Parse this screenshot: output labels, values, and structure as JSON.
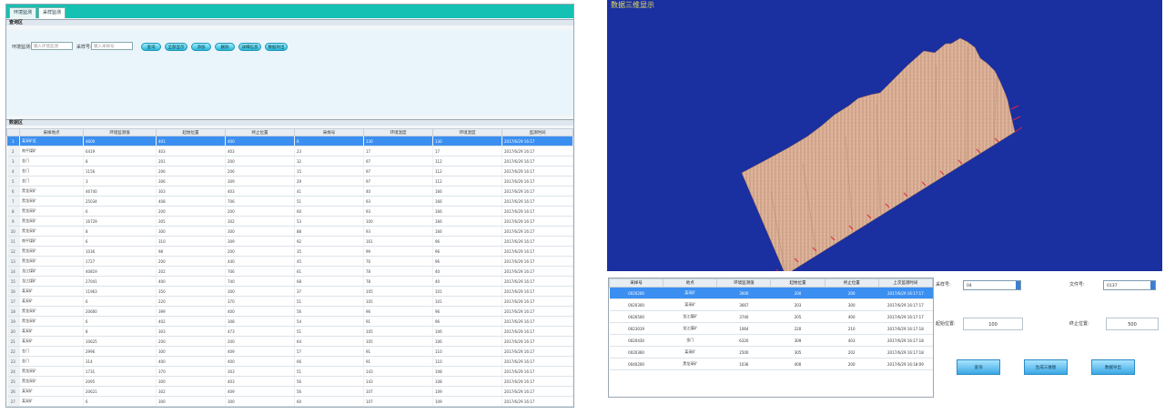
{
  "left": {
    "tabs": [
      "环境监测",
      "采样监测"
    ],
    "query_title": "查询区",
    "grid_title": "数据区",
    "query": {
      "label1": "环境监测:",
      "placeholder1": "输入环境监测",
      "label2": "采样号:",
      "placeholder2": "输入采样号",
      "buttons": [
        "查询",
        "全部显示",
        "添加",
        "删除",
        "详细信息",
        "数据导出"
      ]
    },
    "columns": [
      "",
      "采样地点",
      "环境监测值",
      "起始位置",
      "终止位置",
      "采样号",
      "环境温度",
      "环境湿度",
      "监测时间"
    ],
    "rows": [
      [
        "1",
        "某采矿区",
        "4600",
        "401",
        "400",
        "6",
        "130",
        "130",
        "2017/6/29 16:17"
      ],
      [
        "2",
        "南平煤矿",
        "6419",
        "403",
        "403",
        "23",
        "17",
        "17",
        "2017/6/29 16:17"
      ],
      [
        "3",
        "金门",
        "8",
        "201",
        "200",
        "32",
        "97",
        "112",
        "2017/6/29 16:17"
      ],
      [
        "4",
        "金门",
        "1156",
        "206",
        "206",
        "15",
        "97",
        "112",
        "2017/6/29 16:17"
      ],
      [
        "5",
        "金门",
        "3",
        "306",
        "309",
        "29",
        "97",
        "112",
        "2017/6/29 16:17"
      ],
      [
        "6",
        "黑龙采矿",
        "46740",
        "303",
        "403",
        "41",
        "40",
        "166",
        "2017/6/29 16:17"
      ],
      [
        "7",
        "黑龙采矿",
        "25034",
        "408",
        "706",
        "51",
        "93",
        "166",
        "2017/6/29 16:17"
      ],
      [
        "8",
        "黑龙采矿",
        "6",
        "200",
        "200",
        "60",
        "93",
        "166",
        "2017/6/29 16:17"
      ],
      [
        "9",
        "黑龙采矿",
        "16729",
        "305",
        "302",
        "53",
        "100",
        "166",
        "2017/6/29 16:17"
      ],
      [
        "10",
        "黑龙采矿",
        "8",
        "300",
        "300",
        "88",
        "93",
        "166",
        "2017/6/29 16:17"
      ],
      [
        "11",
        "南平煤矿",
        "6",
        "310",
        "309",
        "92",
        "161",
        "96",
        "2017/6/29 16:17"
      ],
      [
        "12",
        "黑龙采矿",
        "1036",
        "98",
        "200",
        "35",
        "99",
        "96",
        "2017/6/29 16:17"
      ],
      [
        "13",
        "黑龙采矿",
        "1727",
        "200",
        "440",
        "45",
        "76",
        "96",
        "2017/6/29 16:17"
      ],
      [
        "14",
        "龙江煤矿",
        "40819",
        "202",
        "706",
        "61",
        "78",
        "40",
        "2017/6/29 16:17"
      ],
      [
        "15",
        "龙江煤矿",
        "27041",
        "400",
        "740",
        "68",
        "78",
        "40",
        "2017/6/29 16:17"
      ],
      [
        "16",
        "某采矿",
        "11963",
        "350",
        "300",
        "37",
        "105",
        "101",
        "2017/6/29 16:17"
      ],
      [
        "17",
        "某采矿",
        "6",
        "220",
        "370",
        "51",
        "105",
        "101",
        "2017/6/29 16:17"
      ],
      [
        "18",
        "黑龙采矿",
        "20660",
        "399",
        "400",
        "56",
        "96",
        "96",
        "2017/6/29 16:17"
      ],
      [
        "19",
        "黑龙采矿",
        "6",
        "402",
        "308",
        "54",
        "91",
        "96",
        "2017/6/29 16:17"
      ],
      [
        "20",
        "某采矿",
        "8",
        "303",
        "473",
        "51",
        "105",
        "106",
        "2017/6/29 16:17"
      ],
      [
        "21",
        "某采矿",
        "10625",
        "200",
        "200",
        "64",
        "105",
        "106",
        "2017/6/29 16:17"
      ],
      [
        "22",
        "金门",
        "2996",
        "300",
        "409",
        "57",
        "91",
        "110",
        "2017/6/29 16:17"
      ],
      [
        "23",
        "金门",
        "314",
        "400",
        "400",
        "66",
        "91",
        "110",
        "2017/6/29 16:17"
      ],
      [
        "24",
        "黑龙采矿",
        "1731",
        "370",
        "303",
        "51",
        "143",
        "108",
        "2017/6/29 16:17"
      ],
      [
        "25",
        "黑龙采矿",
        "2095",
        "300",
        "403",
        "56",
        "143",
        "108",
        "2017/6/29 16:17"
      ],
      [
        "26",
        "某采矿",
        "20621",
        "302",
        "409",
        "56",
        "107",
        "109",
        "2017/6/29 16:17"
      ],
      [
        "27",
        "某采矿",
        "6",
        "300",
        "300",
        "60",
        "107",
        "109",
        "2017/6/29 16:17"
      ]
    ]
  },
  "right": {
    "title": "数据三维显示",
    "columns": [
      "采样号",
      "地点",
      "环境监测值",
      "起始位置",
      "终止位置",
      "上次监测时间"
    ],
    "rows": [
      [
        "0020200",
        "某采矿",
        "3600",
        "200",
        "200",
        "2017/6/29 16:17:17"
      ],
      [
        "0020300",
        "某采矿",
        "3667",
        "203",
        "300",
        "2017/6/29 16:17:17"
      ],
      [
        "0026500",
        "龙江煤矿",
        "3740",
        "205",
        "400",
        "2017/6/29 16:17:17"
      ],
      [
        "0023019",
        "龙江煤矿",
        "1064",
        "220",
        "210",
        "2017/6/29 16:17:18"
      ],
      [
        "0020430",
        "金门",
        "6320",
        "309",
        "403",
        "2017/6/29 16:17:18"
      ],
      [
        "0020360",
        "某采矿",
        "2500",
        "305",
        "202",
        "2017/6/29 16:17:18"
      ],
      [
        "0040200",
        "黑龙采矿",
        "1036",
        "400",
        "200",
        "2017/6/29 16:18:09"
      ]
    ],
    "controls": {
      "sample_label": "采样号:",
      "sample_value": "04",
      "file_label": "文件号:",
      "file_value": "0137",
      "start_label": "起始位置:",
      "start_value": "100",
      "end_label": "终止位置:",
      "end_value": "500",
      "buttons": [
        "查询",
        "生成三维图",
        "数据导出"
      ]
    }
  }
}
